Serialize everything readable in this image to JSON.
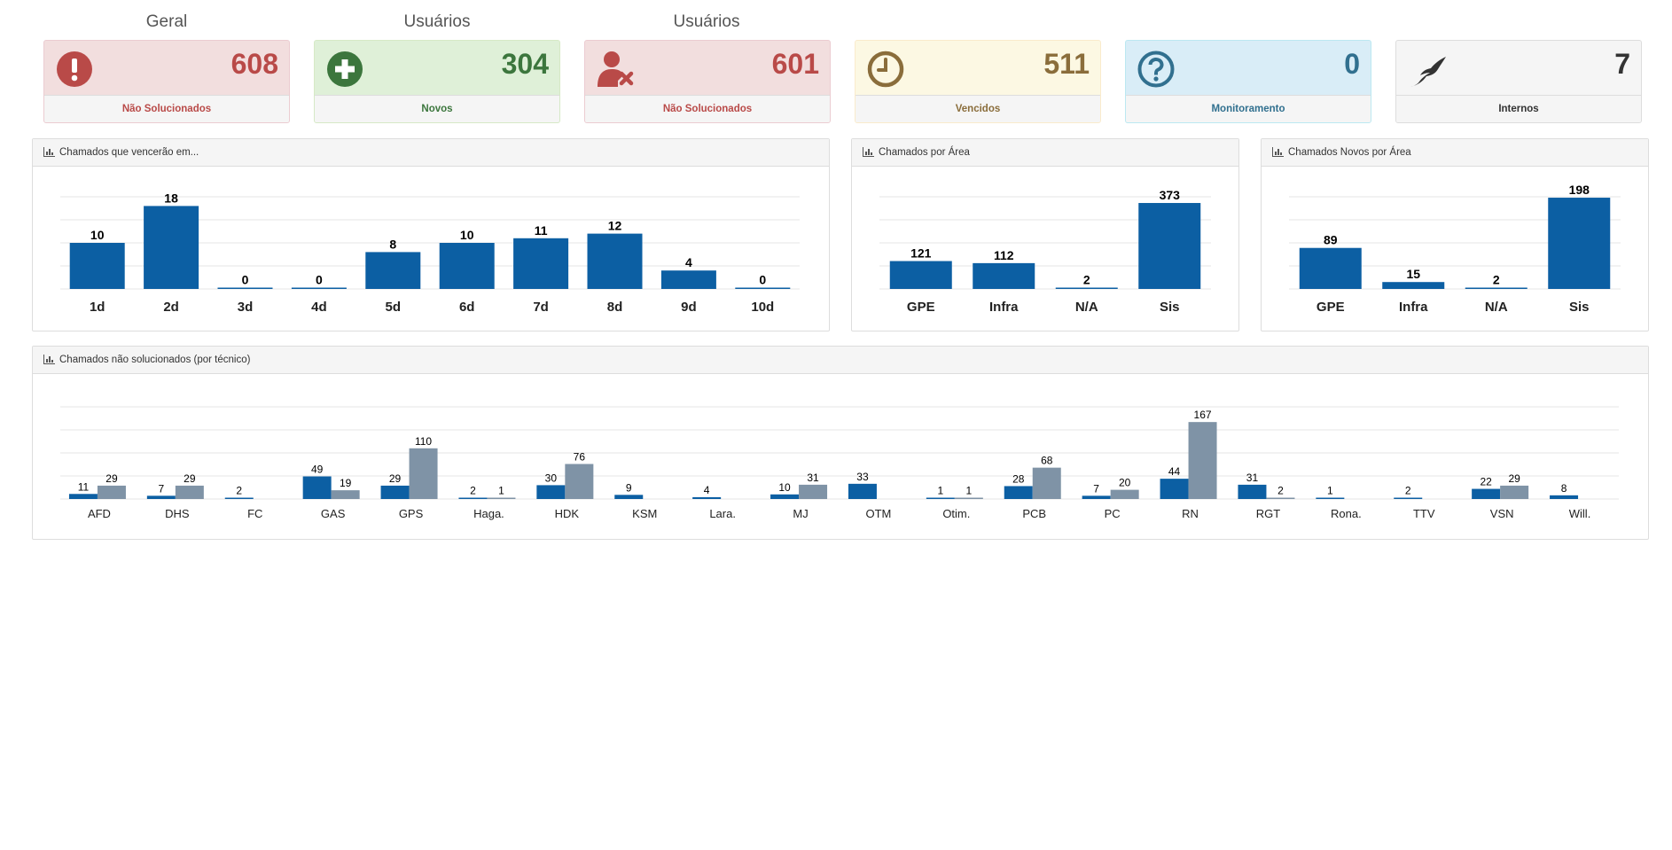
{
  "headings": [
    "Geral",
    "Usuários",
    "Usuários"
  ],
  "stats": [
    {
      "value": "608",
      "label": "Não Solucionados",
      "icon": "exclamation-icon",
      "color": "#b94a48",
      "bg": "#f2dede",
      "border": "#ebccd1"
    },
    {
      "value": "304",
      "label": "Novos",
      "icon": "plus-circle-icon",
      "color": "#3c763d",
      "bg": "#dff0d8",
      "border": "#d6e9c6"
    },
    {
      "value": "601",
      "label": "Não Solucionados",
      "icon": "user-remove-icon",
      "color": "#b94a48",
      "bg": "#f2dede",
      "border": "#ebccd1"
    },
    {
      "value": "511",
      "label": "Vencidos",
      "icon": "clock-icon",
      "color": "#8a6d3b",
      "bg": "#fcf8e3",
      "border": "#faebcc"
    },
    {
      "value": "0",
      "label": "Monitoramento",
      "icon": "question-circle-icon",
      "color": "#31708f",
      "bg": "#d9edf7",
      "border": "#bce8f1"
    },
    {
      "value": "7",
      "label": "Internos",
      "icon": "quill-icon",
      "color": "#333333",
      "bg": "#f5f5f5",
      "border": "#dddddd"
    }
  ],
  "panels": {
    "due": {
      "title": "Chamados que vencerão em..."
    },
    "area": {
      "title": "Chamados por Área"
    },
    "new_area": {
      "title": "Chamados Novos por Área"
    },
    "tech": {
      "title": "Chamados não solucionados (por técnico)"
    }
  },
  "colors": {
    "primary": "#0c5fa3",
    "secondary": "#7f93a6",
    "grid": "#e6e6e6"
  },
  "chart_data": [
    {
      "type": "bar",
      "id": "due",
      "categories": [
        "1d",
        "2d",
        "3d",
        "4d",
        "5d",
        "6d",
        "7d",
        "8d",
        "9d",
        "10d"
      ],
      "values": [
        10,
        18,
        0,
        0,
        8,
        10,
        11,
        12,
        4,
        0
      ],
      "ylim": [
        0,
        20
      ],
      "grid": true
    },
    {
      "type": "bar",
      "id": "area",
      "categories": [
        "GPE",
        "Infra",
        "N/A",
        "Sis"
      ],
      "values": [
        121,
        112,
        2,
        373
      ],
      "ylim": [
        0,
        400
      ],
      "grid": true
    },
    {
      "type": "bar",
      "id": "new_area",
      "categories": [
        "GPE",
        "Infra",
        "N/A",
        "Sis"
      ],
      "values": [
        89,
        15,
        2,
        198
      ],
      "ylim": [
        0,
        200
      ],
      "grid": true
    },
    {
      "type": "bar",
      "id": "tech",
      "categories": [
        "AFD",
        "DHS",
        "FC",
        "GAS",
        "GPS",
        "Haga.",
        "HDK",
        "KSM",
        "Lara.",
        "MJ",
        "OTM",
        "Otim.",
        "PCB",
        "PC",
        "RN",
        "RGT",
        "Rona.",
        "TTV",
        "VSN",
        "Will."
      ],
      "series": [
        {
          "values": [
            11,
            7,
            2,
            49,
            29,
            2,
            30,
            9,
            4,
            10,
            33,
            1,
            28,
            7,
            44,
            31,
            1,
            2,
            22,
            8
          ]
        },
        {
          "values": [
            29,
            29,
            null,
            19,
            110,
            1,
            76,
            null,
            null,
            31,
            null,
            1,
            68,
            20,
            167,
            2,
            null,
            null,
            29,
            null
          ]
        }
      ],
      "ylim": [
        0,
        200
      ],
      "grid": true
    }
  ]
}
